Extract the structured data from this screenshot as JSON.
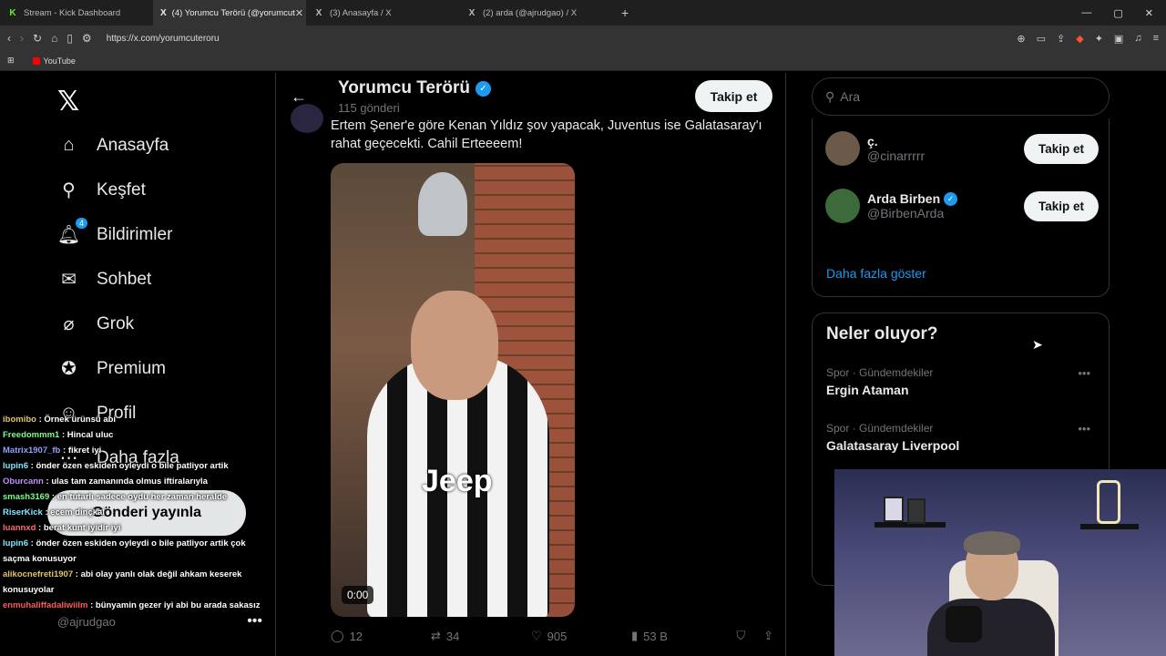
{
  "browser": {
    "tabs": [
      {
        "label": "Stream - Kick Dashboard",
        "icon": "K",
        "color": "#53fc18"
      },
      {
        "label": "(4) Yorumcu Terörü (@yorumcut",
        "icon": "X",
        "color": "#ffffff"
      },
      {
        "label": "(3) Anasayfa / X",
        "icon": "X",
        "color": "#ffffff"
      },
      {
        "label": "(2) arda (@ajrudgao) / X",
        "icon": "X",
        "color": "#ffffff"
      }
    ],
    "url": "https://x.com/yorumcuteroru",
    "bookmark": "YouTube"
  },
  "nav": {
    "items": [
      {
        "label": "Anasayfa",
        "icon": "home-icon"
      },
      {
        "label": "Keşfet",
        "icon": "search-icon"
      },
      {
        "label": "Bildirimler",
        "icon": "bell-icon",
        "badge": "4"
      },
      {
        "label": "Sohbet",
        "icon": "mail-icon"
      },
      {
        "label": "Grok",
        "icon": "grok-icon"
      },
      {
        "label": "Premium",
        "icon": "premium-icon"
      },
      {
        "label": "Profil",
        "icon": "profile-icon"
      },
      {
        "label": "Daha fazla",
        "icon": "more-icon"
      }
    ],
    "post_button": "Gönderi yayınla",
    "account_handle": "@ajrudgao"
  },
  "chat": [
    {
      "user": "ibomibo",
      "color": "#e0c36a",
      "text": "Örnek ürünsü abi"
    },
    {
      "user": "Freedommm1",
      "color": "#7cfc8a",
      "text": "Hincal uluc"
    },
    {
      "user": "Matrix1907_fb",
      "color": "#8fa0ff",
      "text": "fikret iyi"
    },
    {
      "user": "lupin6",
      "color": "#7fe6ff",
      "text": "önder özen eskiden oyleydi o bile patliyor artik"
    },
    {
      "user": "Oburcann",
      "color": "#c58cff",
      "text": "ulas tam zamanında olmus iftiralarıyla"
    },
    {
      "user": "smash3169",
      "color": "#7cfc8a",
      "text": "en tutarlı sadece oydu her zaman heralde"
    },
    {
      "user": "RiserKick",
      "color": "#7fe6ff",
      "text": "ecem dinçkal"
    },
    {
      "user": "luannxd",
      "color": "#ff6b6b",
      "text": "berat kunt iyidir iyi"
    },
    {
      "user": "lupin6",
      "color": "#7fe6ff",
      "text": "önder özen eskiden oyleydi o bile patliyor artik çok saçma konusuyor"
    },
    {
      "user": "alikocnefreti1907",
      "color": "#e0c36a",
      "text": "abi olay yanlı olak değil ahkam keserek konusuyolar"
    },
    {
      "user": "enmuhaliffadaliwiilm",
      "color": "#ff5a5a",
      "text": "bünyamin gezer iyi abi bu arada sakasız"
    }
  ],
  "profile": {
    "name": "Yorumcu Terörü",
    "post_count": "115 gönderi",
    "follow_label": "Takip et"
  },
  "tweet": {
    "text": "Ertem Şener'e göre Kenan Yıldız şov yapacak, Juventus ise Galatasaray'ı rahat geçecekti. Cahil Erteeeem!",
    "video_time": "0:00",
    "media_brand": "Jeep",
    "replies": "12",
    "retweets": "34",
    "likes": "905",
    "views": "53 B"
  },
  "search": {
    "placeholder": "Ara"
  },
  "suggestions": [
    {
      "name": "ç.",
      "handle": "@cinarrrrr",
      "verified": false,
      "follow": "Takip et",
      "avatar_color": "#6b5a4a"
    },
    {
      "name": "Arda Birben",
      "handle": "@BirbenArda",
      "verified": true,
      "follow": "Takip et",
      "avatar_color": "#3d6a3a"
    }
  ],
  "show_more": "Daha fazla göster",
  "trends": {
    "title": "Neler oluyor?",
    "items": [
      {
        "meta": "Spor · Gündemdekiler",
        "name": "Ergin Ataman"
      },
      {
        "meta": "Spor · Gündemdekiler",
        "name": "Galatasaray Liverpool"
      }
    ]
  }
}
